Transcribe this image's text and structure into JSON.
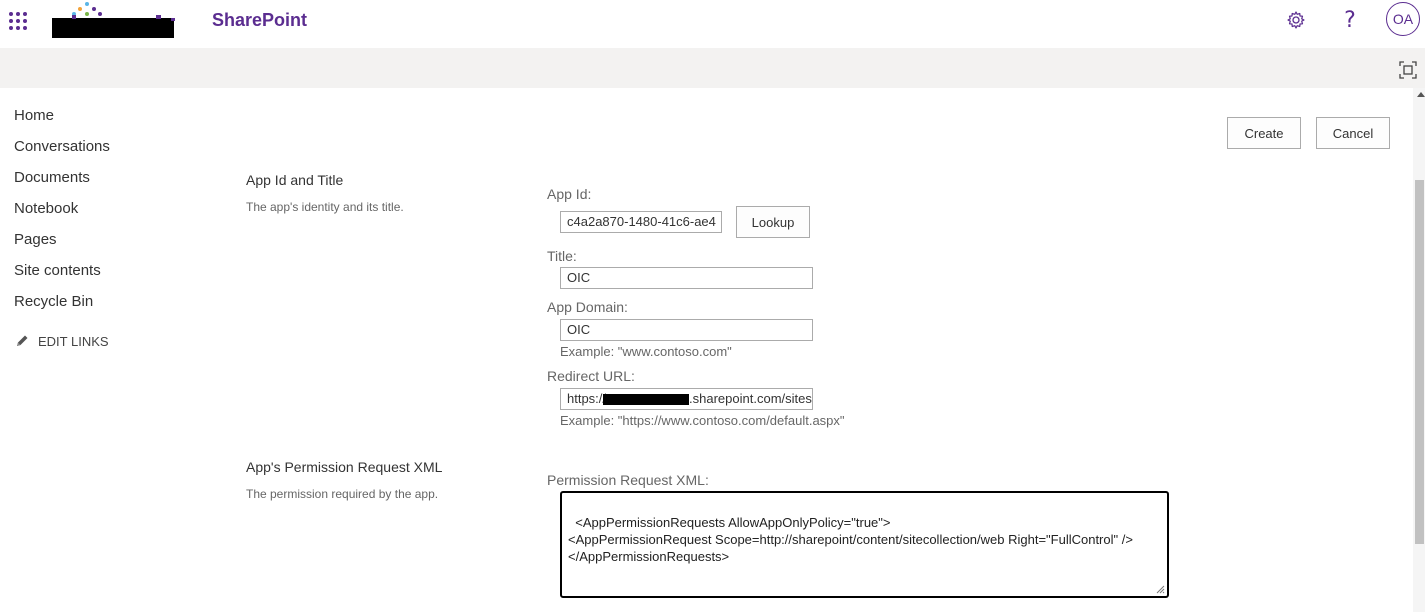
{
  "suite": {
    "app_name": "SharePoint",
    "avatar_initials": "OA",
    "help_glyph": "?",
    "icons": [
      "waffle-icon",
      "gear-icon",
      "help-icon",
      "focus-mode-icon",
      "pencil-icon"
    ]
  },
  "nav": {
    "items": [
      "Home",
      "Conversations",
      "Documents",
      "Notebook",
      "Pages",
      "Site contents",
      "Recycle Bin"
    ],
    "edit_links": "EDIT LINKS"
  },
  "actions": {
    "create": "Create",
    "cancel": "Cancel"
  },
  "sections": {
    "identity": {
      "title": "App Id and Title",
      "description": "The app's identity and its title."
    },
    "permissions": {
      "title": "App's Permission Request XML",
      "description": "The permission required by the app."
    }
  },
  "form": {
    "app_id_label": "App Id:",
    "app_id_value": "c4a2a870-1480-41c6-ae4",
    "lookup": "Lookup",
    "title_label": "Title:",
    "title_value": "OIC",
    "domain_label": "App Domain:",
    "domain_value": "OIC",
    "domain_example": "Example: \"www.contoso.com\"",
    "redirect_label": "Redirect URL:",
    "redirect_prefix": "https://",
    "redirect_suffix": ".sharepoint.com/sites/C",
    "redirect_example": "Example: \"https://www.contoso.com/default.aspx\"",
    "xml_label": "Permission Request XML:",
    "xml_value": "<AppPermissionRequests AllowAppOnlyPolicy=\"true\">\n<AppPermissionRequest Scope=http://sharepoint/content/sitecollection/web Right=\"FullControl\" />\n</AppPermissionRequests>"
  },
  "colors": {
    "brand": "#5b2d90",
    "band": "#f3f2f1"
  }
}
